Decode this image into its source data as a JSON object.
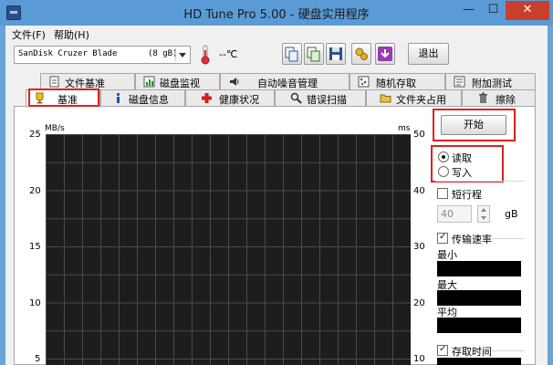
{
  "window": {
    "title": "HD Tune Pro 5.00 - 硬盘实用程序",
    "min_glyph": "—",
    "max_glyph": "☐",
    "close_glyph": "✕"
  },
  "menu": {
    "file": "文件(F)",
    "help": "帮助(H)"
  },
  "toolbar": {
    "drive_name": "SanDisk Cruzer Blade",
    "drive_size": "(8 gB)",
    "temperature": "--℃",
    "exit_label": "退出"
  },
  "tabs_top": [
    {
      "label": "文件基准",
      "icon": "file-benchmark-icon"
    },
    {
      "label": "磁盘监视",
      "icon": "disk-monitor-icon"
    },
    {
      "label": "自动噪音管理",
      "icon": "speaker-icon"
    },
    {
      "label": "随机存取",
      "icon": "random-access-icon"
    },
    {
      "label": "附加测试",
      "icon": "extra-tests-icon"
    }
  ],
  "tabs_bottom": [
    {
      "label": "基准",
      "icon": "benchmark-icon",
      "active": true
    },
    {
      "label": "磁盘信息",
      "icon": "info-icon"
    },
    {
      "label": "健康状况",
      "icon": "health-cross-icon"
    },
    {
      "label": "错误扫描",
      "icon": "magnifier-icon"
    },
    {
      "label": "文件夹占用",
      "icon": "folder-icon"
    },
    {
      "label": "擦除",
      "icon": "trash-icon"
    }
  ],
  "chart": {
    "left_unit": "MB/s",
    "right_unit": "ms",
    "left_ticks": [
      "25",
      "20",
      "15",
      "10",
      "5"
    ],
    "right_ticks": [
      "50",
      "40",
      "30",
      "20",
      "10"
    ],
    "background": "#1d1d1d",
    "grid_color": "#4a4a4a"
  },
  "controls": {
    "start_label": "开始",
    "read_label": "读取",
    "write_label": "写入",
    "mode_selected": "读取",
    "short_stroke_label": "短行程",
    "short_stroke_checked": false,
    "short_stroke_value": "40",
    "short_stroke_unit": "gB",
    "transfer_rate_label": "传输速率",
    "transfer_rate_checked": true,
    "min_label": "最小",
    "max_label": "最大",
    "avg_label": "平均",
    "access_time_label": "存取时间",
    "access_time_checked": true
  },
  "colors": {
    "titlebar": "#5a9bd5",
    "close": "#c7402d",
    "highlight": "#e02020"
  }
}
